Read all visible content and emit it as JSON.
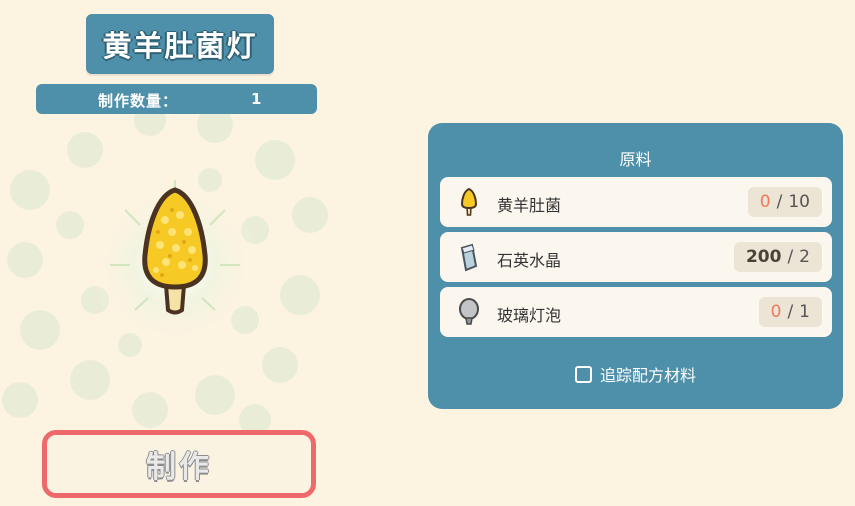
{
  "recipe": {
    "title": "黄羊肚菌灯",
    "quantity_label": "制作数量：",
    "quantity_value": "1"
  },
  "craft_button": {
    "label": "制作"
  },
  "materials_panel": {
    "header": "原料",
    "items": [
      {
        "icon": "morel-mushroom-icon",
        "name": "黄羊肚菌",
        "have": "0",
        "need": "10",
        "sufficient": false
      },
      {
        "icon": "quartz-crystal-icon",
        "name": "石英水晶",
        "have": "200",
        "need": "2",
        "sufficient": true
      },
      {
        "icon": "glass-bulb-icon",
        "name": "玻璃灯泡",
        "have": "0",
        "need": "1",
        "sufficient": false
      }
    ],
    "track_label": "追踪配方材料",
    "track_checked": false
  },
  "colors": {
    "panel_blue": "#4e8fa9",
    "background": "#fdf3e1",
    "craft_border": "#ee6a6a",
    "insufficient": "#f07a5c"
  }
}
